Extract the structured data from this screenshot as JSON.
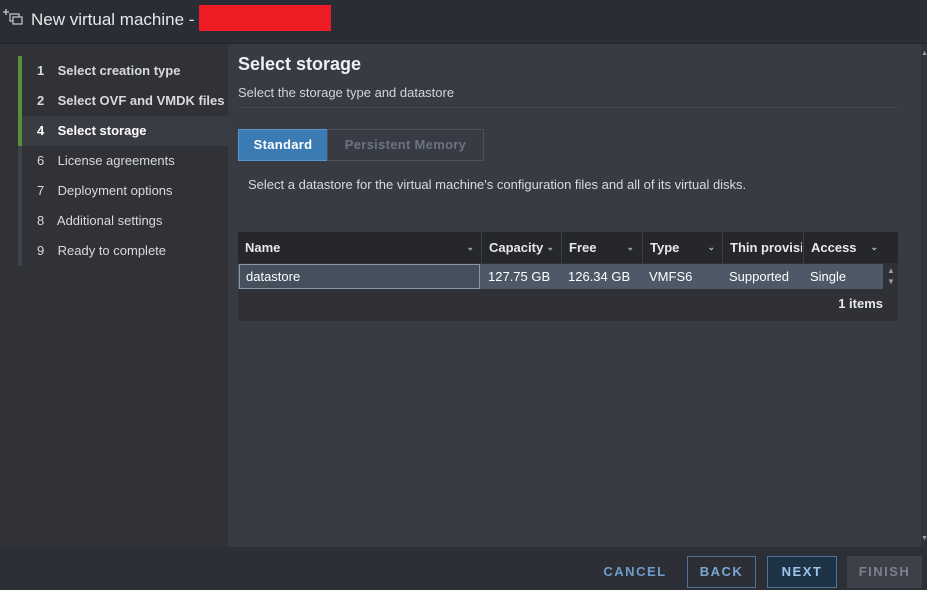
{
  "window": {
    "title": "New virtual machine -",
    "icon": "add-vm-icon"
  },
  "sidebar": {
    "steps": [
      {
        "num": "1",
        "label": "Select creation type",
        "state": "done"
      },
      {
        "num": "2",
        "label": "Select OVF and VMDK files",
        "state": "done"
      },
      {
        "num": "4",
        "label": "Select storage",
        "state": "active"
      },
      {
        "num": "6",
        "label": "License agreements",
        "state": "pending"
      },
      {
        "num": "7",
        "label": "Deployment options",
        "state": "pending"
      },
      {
        "num": "8",
        "label": "Additional settings",
        "state": "pending"
      },
      {
        "num": "9",
        "label": "Ready to complete",
        "state": "pending"
      }
    ]
  },
  "main": {
    "title": "Select storage",
    "subtitle": "Select the storage type and datastore",
    "storage_types": [
      "Standard",
      "Persistent Memory"
    ],
    "selected_storage_type": "Standard",
    "description": "Select a datastore for the virtual machine's configuration files and all of its virtual disks."
  },
  "table": {
    "columns": [
      "Name",
      "Capacity",
      "Free",
      "Type",
      "Thin provisio",
      "Access"
    ],
    "rows": [
      {
        "name": "datastore",
        "capacity": "127.75 GB",
        "free": "126.34 GB",
        "type": "VMFS6",
        "thin": "Supported",
        "access": "Single"
      }
    ],
    "footer": "1 items"
  },
  "footer": {
    "cancel": "CANCEL",
    "back": "BACK",
    "next": "NEXT",
    "finish": "FINISH"
  },
  "colors": {
    "accent": "#3b7bb3",
    "step_done": "#5a8f3a",
    "redaction": "#ee1c25"
  }
}
